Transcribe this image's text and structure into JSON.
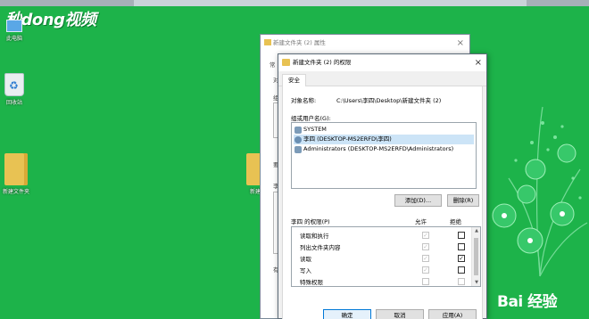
{
  "watermarks": {
    "top_left": "秒dong视频",
    "bottom_right": "Bai 经验"
  },
  "desktop": {
    "icons": [
      {
        "label": "此电脑"
      },
      {
        "label": "回收站"
      },
      {
        "label": "新建文件夹"
      },
      {
        "label": "新建文"
      }
    ]
  },
  "back_dialog": {
    "title": "新建文件夹 (2) 属性",
    "tab_fragment": "常",
    "side_fragments": [
      "对",
      "组",
      "要",
      "李",
      "有"
    ]
  },
  "front_dialog": {
    "title": "新建文件夹 (2) 的权限",
    "tab": "安全",
    "object_label": "对象名称:",
    "object_value": "C:\\Users\\李四\\Desktop\\新建文件夹 (2)",
    "users_label": "组或用户名(G):",
    "users": [
      {
        "name": "SYSTEM",
        "selected": false,
        "icon": "user-group-icon"
      },
      {
        "name": "李四 (DESKTOP-MS2ERFD\\李四)",
        "selected": true,
        "icon": "user-icon"
      },
      {
        "name": "Administrators (DESKTOP-MS2ERFD\\Administrators)",
        "selected": false,
        "icon": "user-group-icon"
      }
    ],
    "add_button": "添加(D)...",
    "remove_button": "删除(R)",
    "perm_header": "李四 的权限(P)",
    "allow_header": "允许",
    "deny_header": "拒绝",
    "permissions": [
      {
        "name": "读取和执行",
        "allow": true,
        "deny": false
      },
      {
        "name": "列出文件夹内容",
        "allow": true,
        "deny": false
      },
      {
        "name": "读取",
        "allow": true,
        "deny": true
      },
      {
        "name": "写入",
        "allow": true,
        "deny": false
      },
      {
        "name": "特殊权限",
        "allow": false,
        "deny": false
      }
    ],
    "ok_button": "确定",
    "cancel_button": "取消",
    "apply_button": "应用(A)"
  },
  "colors": {
    "desktop_bg": "#1db34a",
    "accent": "#0078d7"
  }
}
